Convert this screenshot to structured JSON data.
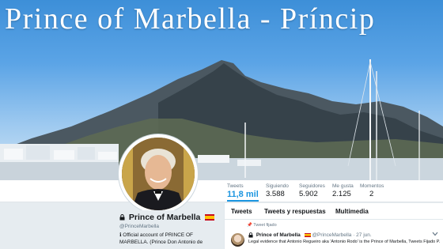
{
  "banner": {
    "title": "Prince of Marbella  -  Príncip"
  },
  "stats": [
    {
      "label": "Tweets",
      "value": "11,8 mil"
    },
    {
      "label": "Siguiendo",
      "value": "3.588"
    },
    {
      "label": "Seguidores",
      "value": "5.902"
    },
    {
      "label": "Me gusta",
      "value": "2.125"
    },
    {
      "label": "Momentos",
      "value": "2"
    }
  ],
  "profile": {
    "name": "Prince of Marbella",
    "handle": "@PrinceMarbella",
    "bio_line1": "ℹ Official account of PRINCE OF",
    "bio_line2": "MARBELLA. (Prince Don Antonio de"
  },
  "timeline": {
    "tabs": [
      "Tweets",
      "Tweets y respuestas",
      "Multimedia"
    ],
    "pinned_label": "Tweet fijado",
    "tweet": {
      "author": "Prince of Marbella",
      "handle_time": "@PrinceMarbella · 27 jun.",
      "text": "Legal evidence that Antonio Regueiro aka 'Antonio Rodo' is the Prince of Marbella, Tweets Fijado P..."
    }
  },
  "colors": {
    "accent": "#1b95e0",
    "sky_top": "#3d8fd8",
    "mountain": "#3f4a52"
  }
}
